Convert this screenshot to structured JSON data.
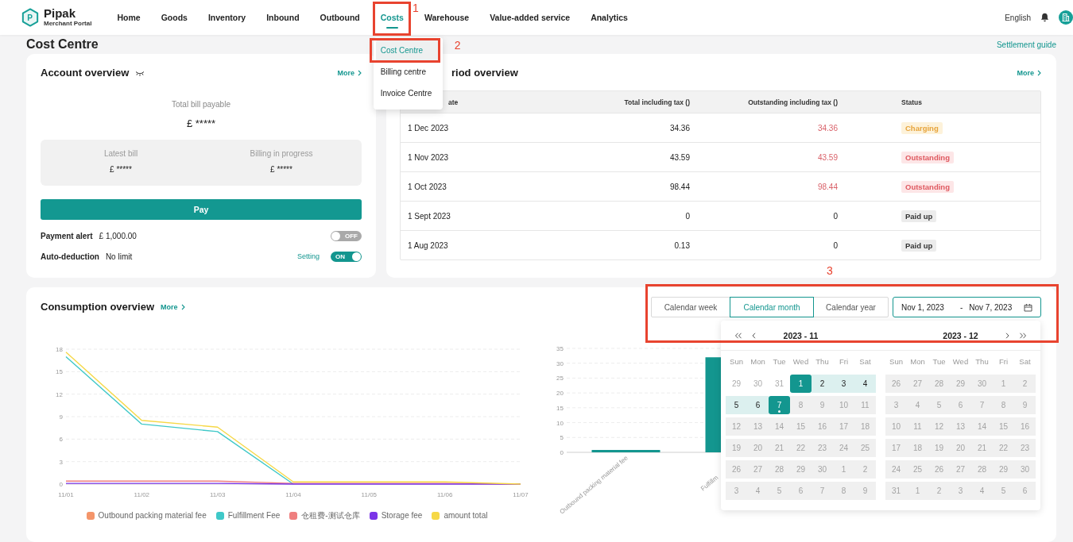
{
  "header": {
    "logo": {
      "mark": "P",
      "name": "Pipak",
      "subtitle": "Merchant Portal"
    },
    "nav": [
      {
        "label": "Home",
        "selected": false
      },
      {
        "label": "Goods",
        "selected": false
      },
      {
        "label": "Inventory",
        "selected": false
      },
      {
        "label": "Inbound",
        "selected": false
      },
      {
        "label": "Outbound",
        "selected": false
      },
      {
        "label": "Costs",
        "selected": true,
        "callout": "1",
        "menu": [
          {
            "label": "Cost Centre",
            "selected": true,
            "callout": "2"
          },
          {
            "label": "Billing centre",
            "selected": false
          },
          {
            "label": "Invoice Centre",
            "selected": false
          }
        ]
      },
      {
        "label": "Warehouse",
        "selected": false
      },
      {
        "label": "Value-added service",
        "selected": false
      },
      {
        "label": "Analytics",
        "selected": false
      }
    ],
    "language": "English"
  },
  "page": {
    "title": "Cost Centre",
    "link": "Settlement guide"
  },
  "account_overview": {
    "title": "Account overview",
    "more": "More",
    "total_label": "Total bill payable",
    "total_value": "£ *****",
    "bills": [
      {
        "label": "Latest bill",
        "value": "£ *****"
      },
      {
        "label": "Billing in progress",
        "value": "£ *****"
      }
    ],
    "pay_button": "Pay",
    "settings": [
      {
        "label": "Payment alert",
        "value": "£ 1,000.00",
        "on": false,
        "toggle_text": "OFF"
      },
      {
        "label": "Auto-deduction",
        "value": "No limit",
        "link": "Setting",
        "on": true,
        "toggle_text": "ON"
      }
    ]
  },
  "billing_period_overview": {
    "title": "riod overview",
    "more": "More",
    "table": {
      "columns": [
        "ate",
        "Total including tax ()",
        "Outstanding including tax ()",
        "Status"
      ],
      "rows": [
        {
          "date": "1 Dec 2023",
          "total": "34.36",
          "outstanding": "34.36",
          "status": {
            "label": "Charging",
            "kind": "charging"
          }
        },
        {
          "date": "1 Nov 2023",
          "total": "43.59",
          "outstanding": "43.59",
          "status": {
            "label": "Outstanding",
            "kind": "outstanding"
          }
        },
        {
          "date": "1 Oct 2023",
          "total": "98.44",
          "outstanding": "98.44",
          "status": {
            "label": "Outstanding",
            "kind": "outstanding"
          }
        },
        {
          "date": "1 Sept 2023",
          "total": "0",
          "outstanding": "0",
          "status": {
            "label": "Paid up",
            "kind": "paid"
          }
        },
        {
          "date": "1 Aug 2023",
          "total": "0.13",
          "outstanding": "0",
          "status": {
            "label": "Paid up",
            "kind": "paid"
          }
        }
      ]
    }
  },
  "consumption_overview": {
    "title": "Consumption overview",
    "more": "More",
    "callout": "3",
    "periods": [
      {
        "label": "Calendar week",
        "selected": false
      },
      {
        "label": "Calendar month",
        "selected": true
      },
      {
        "label": "Calendar year",
        "selected": false
      }
    ],
    "date_range": {
      "start": "Nov 1, 2023",
      "separator": "-",
      "end": "Nov 7, 2023"
    },
    "date_picker": {
      "months": [
        {
          "title": "2023 - 11",
          "weekdays": [
            "Sun",
            "Mon",
            "Tue",
            "Wed",
            "Thu",
            "Fri",
            "Sat"
          ],
          "weeks": [
            [
              {
                "d": "29",
                "kind": "outside",
                "today": false
              },
              {
                "d": "30",
                "kind": "outside",
                "today": false
              },
              {
                "d": "31",
                "kind": "outside",
                "today": false
              },
              {
                "d": "1",
                "kind": "selected",
                "today": false
              },
              {
                "d": "2",
                "kind": "range",
                "today": false
              },
              {
                "d": "3",
                "kind": "range",
                "today": false
              },
              {
                "d": "4",
                "kind": "range",
                "today": false
              }
            ],
            [
              {
                "d": "5",
                "kind": "range",
                "today": false
              },
              {
                "d": "6",
                "kind": "range",
                "today": false
              },
              {
                "d": "7",
                "kind": "selected",
                "today": true
              },
              {
                "d": "8",
                "kind": "disabled",
                "today": false
              },
              {
                "d": "9",
                "kind": "disabled",
                "today": false
              },
              {
                "d": "10",
                "kind": "disabled",
                "today": false
              },
              {
                "d": "11",
                "kind": "disabled",
                "today": false
              }
            ],
            [
              {
                "d": "12",
                "kind": "disabled",
                "today": false
              },
              {
                "d": "13",
                "kind": "disabled",
                "today": false
              },
              {
                "d": "14",
                "kind": "disabled",
                "today": false
              },
              {
                "d": "15",
                "kind": "disabled",
                "today": false
              },
              {
                "d": "16",
                "kind": "disabled",
                "today": false
              },
              {
                "d": "17",
                "kind": "disabled",
                "today": false
              },
              {
                "d": "18",
                "kind": "disabled",
                "today": false
              }
            ],
            [
              {
                "d": "19",
                "kind": "disabled",
                "today": false
              },
              {
                "d": "20",
                "kind": "disabled",
                "today": false
              },
              {
                "d": "21",
                "kind": "disabled",
                "today": false
              },
              {
                "d": "22",
                "kind": "disabled",
                "today": false
              },
              {
                "d": "23",
                "kind": "disabled",
                "today": false
              },
              {
                "d": "24",
                "kind": "disabled",
                "today": false
              },
              {
                "d": "25",
                "kind": "disabled",
                "today": false
              }
            ],
            [
              {
                "d": "26",
                "kind": "disabled",
                "today": false
              },
              {
                "d": "27",
                "kind": "disabled",
                "today": false
              },
              {
                "d": "28",
                "kind": "disabled",
                "today": false
              },
              {
                "d": "29",
                "kind": "disabled",
                "today": false
              },
              {
                "d": "30",
                "kind": "disabled",
                "today": false
              },
              {
                "d": "1",
                "kind": "disabled",
                "today": false
              },
              {
                "d": "2",
                "kind": "disabled",
                "today": false
              }
            ],
            [
              {
                "d": "3",
                "kind": "disabled",
                "today": false
              },
              {
                "d": "4",
                "kind": "disabled",
                "today": false
              },
              {
                "d": "5",
                "kind": "disabled",
                "today": false
              },
              {
                "d": "6",
                "kind": "disabled",
                "today": false
              },
              {
                "d": "7",
                "kind": "disabled",
                "today": false
              },
              {
                "d": "8",
                "kind": "disabled",
                "today": false
              },
              {
                "d": "9",
                "kind": "disabled",
                "today": false
              }
            ]
          ]
        },
        {
          "title": "2023 - 12",
          "weekdays": [
            "Sun",
            "Mon",
            "Tue",
            "Wed",
            "Thu",
            "Fri",
            "Sat"
          ],
          "weeks": [
            [
              {
                "d": "26",
                "kind": "disabled",
                "today": false
              },
              {
                "d": "27",
                "kind": "disabled",
                "today": false
              },
              {
                "d": "28",
                "kind": "disabled",
                "today": false
              },
              {
                "d": "29",
                "kind": "disabled",
                "today": false
              },
              {
                "d": "30",
                "kind": "disabled",
                "today": false
              },
              {
                "d": "1",
                "kind": "disabled",
                "today": false
              },
              {
                "d": "2",
                "kind": "disabled",
                "today": false
              }
            ],
            [
              {
                "d": "3",
                "kind": "disabled",
                "today": false
              },
              {
                "d": "4",
                "kind": "disabled",
                "today": false
              },
              {
                "d": "5",
                "kind": "disabled",
                "today": false
              },
              {
                "d": "6",
                "kind": "disabled",
                "today": false
              },
              {
                "d": "7",
                "kind": "disabled",
                "today": false
              },
              {
                "d": "8",
                "kind": "disabled",
                "today": false
              },
              {
                "d": "9",
                "kind": "disabled",
                "today": false
              }
            ],
            [
              {
                "d": "10",
                "kind": "disabled",
                "today": false
              },
              {
                "d": "11",
                "kind": "disabled",
                "today": false
              },
              {
                "d": "12",
                "kind": "disabled",
                "today": false
              },
              {
                "d": "13",
                "kind": "disabled",
                "today": false
              },
              {
                "d": "14",
                "kind": "disabled",
                "today": false
              },
              {
                "d": "15",
                "kind": "disabled",
                "today": false
              },
              {
                "d": "16",
                "kind": "disabled",
                "today": false
              }
            ],
            [
              {
                "d": "17",
                "kind": "disabled",
                "today": false
              },
              {
                "d": "18",
                "kind": "disabled",
                "today": false
              },
              {
                "d": "19",
                "kind": "disabled",
                "today": false
              },
              {
                "d": "20",
                "kind": "disabled",
                "today": false
              },
              {
                "d": "21",
                "kind": "disabled",
                "today": false
              },
              {
                "d": "22",
                "kind": "disabled",
                "today": false
              },
              {
                "d": "23",
                "kind": "disabled",
                "today": false
              }
            ],
            [
              {
                "d": "24",
                "kind": "disabled",
                "today": false
              },
              {
                "d": "25",
                "kind": "disabled",
                "today": false
              },
              {
                "d": "26",
                "kind": "disabled",
                "today": false
              },
              {
                "d": "27",
                "kind": "disabled",
                "today": false
              },
              {
                "d": "28",
                "kind": "disabled",
                "today": false
              },
              {
                "d": "29",
                "kind": "disabled",
                "today": false
              },
              {
                "d": "30",
                "kind": "disabled",
                "today": false
              }
            ],
            [
              {
                "d": "31",
                "kind": "disabled",
                "today": false
              },
              {
                "d": "1",
                "kind": "disabled",
                "today": false
              },
              {
                "d": "2",
                "kind": "disabled",
                "today": false
              },
              {
                "d": "3",
                "kind": "disabled",
                "today": false
              },
              {
                "d": "4",
                "kind": "disabled",
                "today": false
              },
              {
                "d": "5",
                "kind": "disabled",
                "today": false
              },
              {
                "d": "6",
                "kind": "disabled",
                "today": false
              }
            ]
          ]
        }
      ]
    },
    "line_chart": {
      "chart_data": {
        "type": "line",
        "grid": true,
        "categories": [
          "11/01",
          "11/02",
          "11/03",
          "11/04",
          "11/05",
          "11/06",
          "11/07"
        ],
        "ylim": [
          0,
          18
        ],
        "yticks": [
          0,
          3,
          6,
          9,
          12,
          15,
          18
        ],
        "series": [
          {
            "name": "Outbound packing material fee",
            "color": "#f4956a",
            "values": [
              null,
              null,
              null,
              null,
              null,
              null,
              null
            ]
          },
          {
            "name": "Fulfillment Fee",
            "color": "#3fc8c8",
            "values": [
              17,
              8,
              7,
              0,
              null,
              null,
              null
            ]
          },
          {
            "name": "仓租费-测试仓库",
            "color": "#ef7f7f",
            "values": [
              0.4,
              0.4,
              0.4,
              0.1,
              0.1,
              0.1,
              0
            ]
          },
          {
            "name": "Storage fee",
            "color": "#7b35e8",
            "values": [
              0.1,
              0.1,
              0.1,
              0,
              0,
              0,
              0
            ]
          },
          {
            "name": "amount total",
            "color": "#f6d846",
            "values": [
              17.6,
              8.5,
              7.6,
              0.3,
              0.3,
              0.3,
              0
            ]
          }
        ]
      }
    },
    "bar_chart": {
      "chart_data": {
        "type": "bar",
        "grid": true,
        "categories": [
          "Outbound packing material fee",
          "Fulfillm"
        ],
        "values": [
          0.8,
          32
        ],
        "ylim": [
          0,
          35
        ],
        "yticks": [
          0,
          5,
          10,
          15,
          20,
          25,
          30,
          35
        ]
      }
    }
  }
}
